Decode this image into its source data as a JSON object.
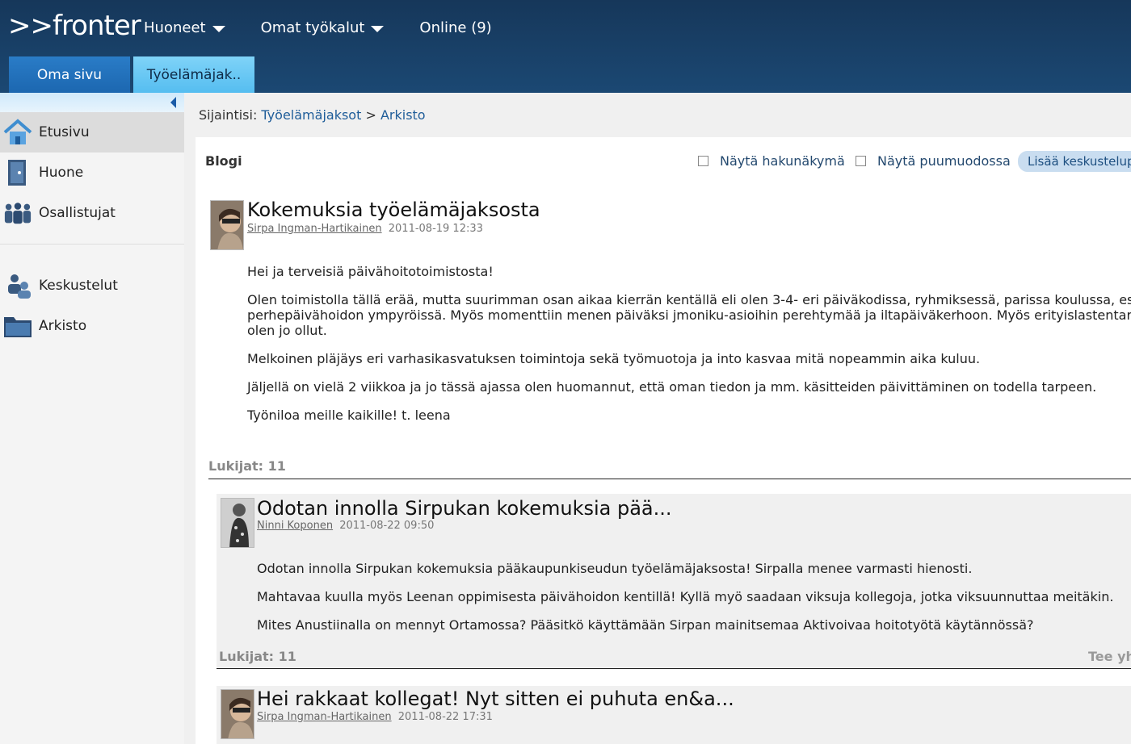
{
  "header": {
    "logo": ">>fronter",
    "nav": [
      "Huoneet",
      "Omat työkalut",
      "Online (9)"
    ],
    "tabs": [
      "Oma sivu",
      "Työelämäjak.."
    ]
  },
  "sidebar": {
    "items": [
      {
        "label": "Etusivu",
        "icon": "home-icon"
      },
      {
        "label": "Huone",
        "icon": "door-icon"
      },
      {
        "label": "Osallistujat",
        "icon": "people-icon"
      },
      {
        "label": "Keskustelut",
        "icon": "discussion-icon"
      },
      {
        "label": "Arkisto",
        "icon": "folder-icon"
      }
    ]
  },
  "breadcrumb": {
    "prefix": "Sijaintisi:",
    "path1": "Työelämäjaksot",
    "sep": ">",
    "path2": "Arkisto"
  },
  "blog": {
    "label": "Blogi",
    "opt1": "Näytä hakunäkymä",
    "opt2": "Näytä puumuodossa",
    "add": "Lisää keskustelup"
  },
  "post": {
    "title": "Kokemuksia työelämäjaksosta",
    "author": "Sirpa Ingman-Hartikainen",
    "date": "2011-08-19 12:33",
    "body": [
      "Hei ja terveisiä päivähoitotoimistosta!",
      "Olen toimistolla tällä erää, mutta suurimman osan aikaa kierrän kentällä eli olen 3-4- eri päiväkodissa, ryhmiksessä, parissa koulussa, esiopetuksessa ja",
      "perhepäivähoidon ympyröissä. Myös momenttiin menen päiväksi jmoniku-asioihin perehtymää ja  iltapäiväkerhoon. Myös erityislastentarhassa",
      "olen jo ollut.",
      "Melkoinen pläjäys eri varhasikasvatuksen toimintoja  sekä työmuotoja ja into kasvaa mitä nopeammin aika kuluu.",
      "Jäljellä on vielä 2 viikkoa ja jo tässä ajassa olen huomannut, että oman tiedon ja mm. käsitteiden päivittäminen on todella tarpeen.",
      "Työniloa meille kaikille! t. leena"
    ],
    "readers": "Lukijat: 11"
  },
  "reply1": {
    "title": "Odotan innolla Sirpukan kokemuksia pää...",
    "author": "Ninni Koponen",
    "date": "2011-08-22 09:50",
    "body": [
      "Odotan innolla Sirpukan kokemuksia pääkaupunkiseudun työelämäjaksosta! Sirpalla menee varmasti hienosti.",
      "Mahtavaa kuulla myös Leenan oppimisesta päivähoidon kentillä! Kyllä myö saadaan viksuja kollegoja, jotka viksuunnuttaa meitäkin.",
      "Mites Anustiinalla on mennyt Ortamossa? Pääsitkö käyttämään Sirpan mainitsemaa Aktivoivaa hoitotyötä käytännössä?"
    ],
    "readers": "Lukijat: 11",
    "action": "Tee yhteenveto"
  },
  "reply2": {
    "title": "Hei rakkaat kollegat! Nyt sitten ei puhuta en&a...",
    "author": "Sirpa Ingman-Hartikainen",
    "date": "2011-08-22 17:31"
  }
}
